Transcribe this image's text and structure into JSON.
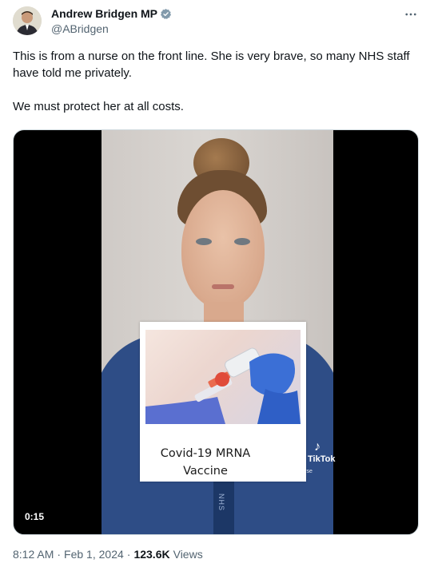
{
  "author": {
    "display_name": "Andrew Bridgen MP",
    "handle": "@ABridgen",
    "verified_color": "#829aab"
  },
  "tweet": {
    "paragraphs": [
      "This is from a nurse on the front line. She is very brave, so many NHS staff have told me privately.",
      "We must protect her at all costs."
    ]
  },
  "media": {
    "type": "video",
    "duration": "0:15",
    "overlay_caption_line1": "Covid-19 MRNA",
    "overlay_caption_line2": "Vaccine",
    "tiktok_label": "TikTok",
    "tiktok_handle": "@...fulnurse",
    "lanyard_text": "NHS"
  },
  "meta": {
    "time": "8:12 AM",
    "date": "Feb 1, 2024",
    "views_count": "123.6K",
    "views_label": "Views"
  },
  "icons": {
    "more": "more-icon",
    "verified": "verified-badge-icon"
  }
}
